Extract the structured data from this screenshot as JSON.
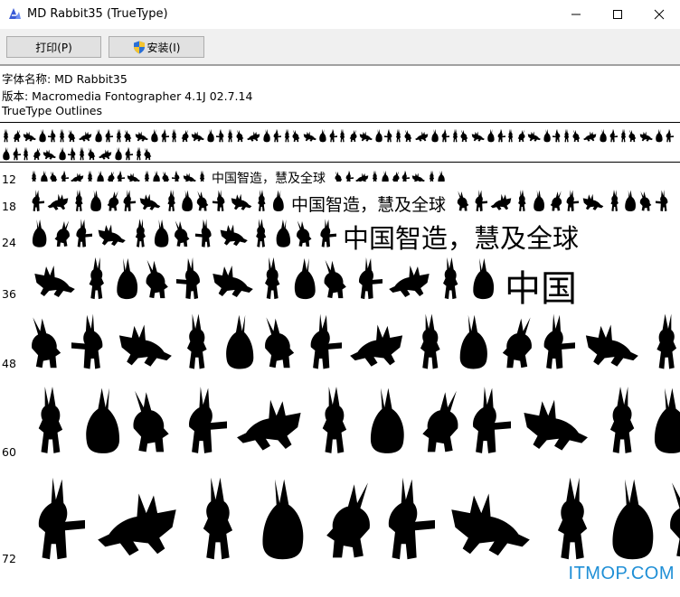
{
  "window": {
    "title": "MD Rabbit35 (TrueType)",
    "app_icon": "font-viewer-icon",
    "controls": [
      "minimize-icon",
      "maximize-icon",
      "close-icon"
    ]
  },
  "toolbar": {
    "print_label": "打印(P)",
    "install_label": "安装(I)",
    "install_icon": "uac-shield-icon"
  },
  "info": {
    "font_name": "字体名称: MD Rabbit35",
    "version": "版本: Macromedia Fontographer 4.1J 02.7.14",
    "outline_type": "TrueType Outlines"
  },
  "sample_text": "中国智造，慧及全球",
  "sizes": [
    {
      "size": "12",
      "cjk": "中国智造，慧及全球"
    },
    {
      "size": "18",
      "cjk": "中国智造，慧及全球"
    },
    {
      "size": "24",
      "cjk": "中国智造，慧及全球"
    },
    {
      "size": "36",
      "cjk": "中国"
    },
    {
      "size": "48",
      "cjk": ""
    },
    {
      "size": "60",
      "cjk": ""
    },
    {
      "size": "72",
      "cjk": ""
    }
  ],
  "watermark": "ITMOP.COM"
}
